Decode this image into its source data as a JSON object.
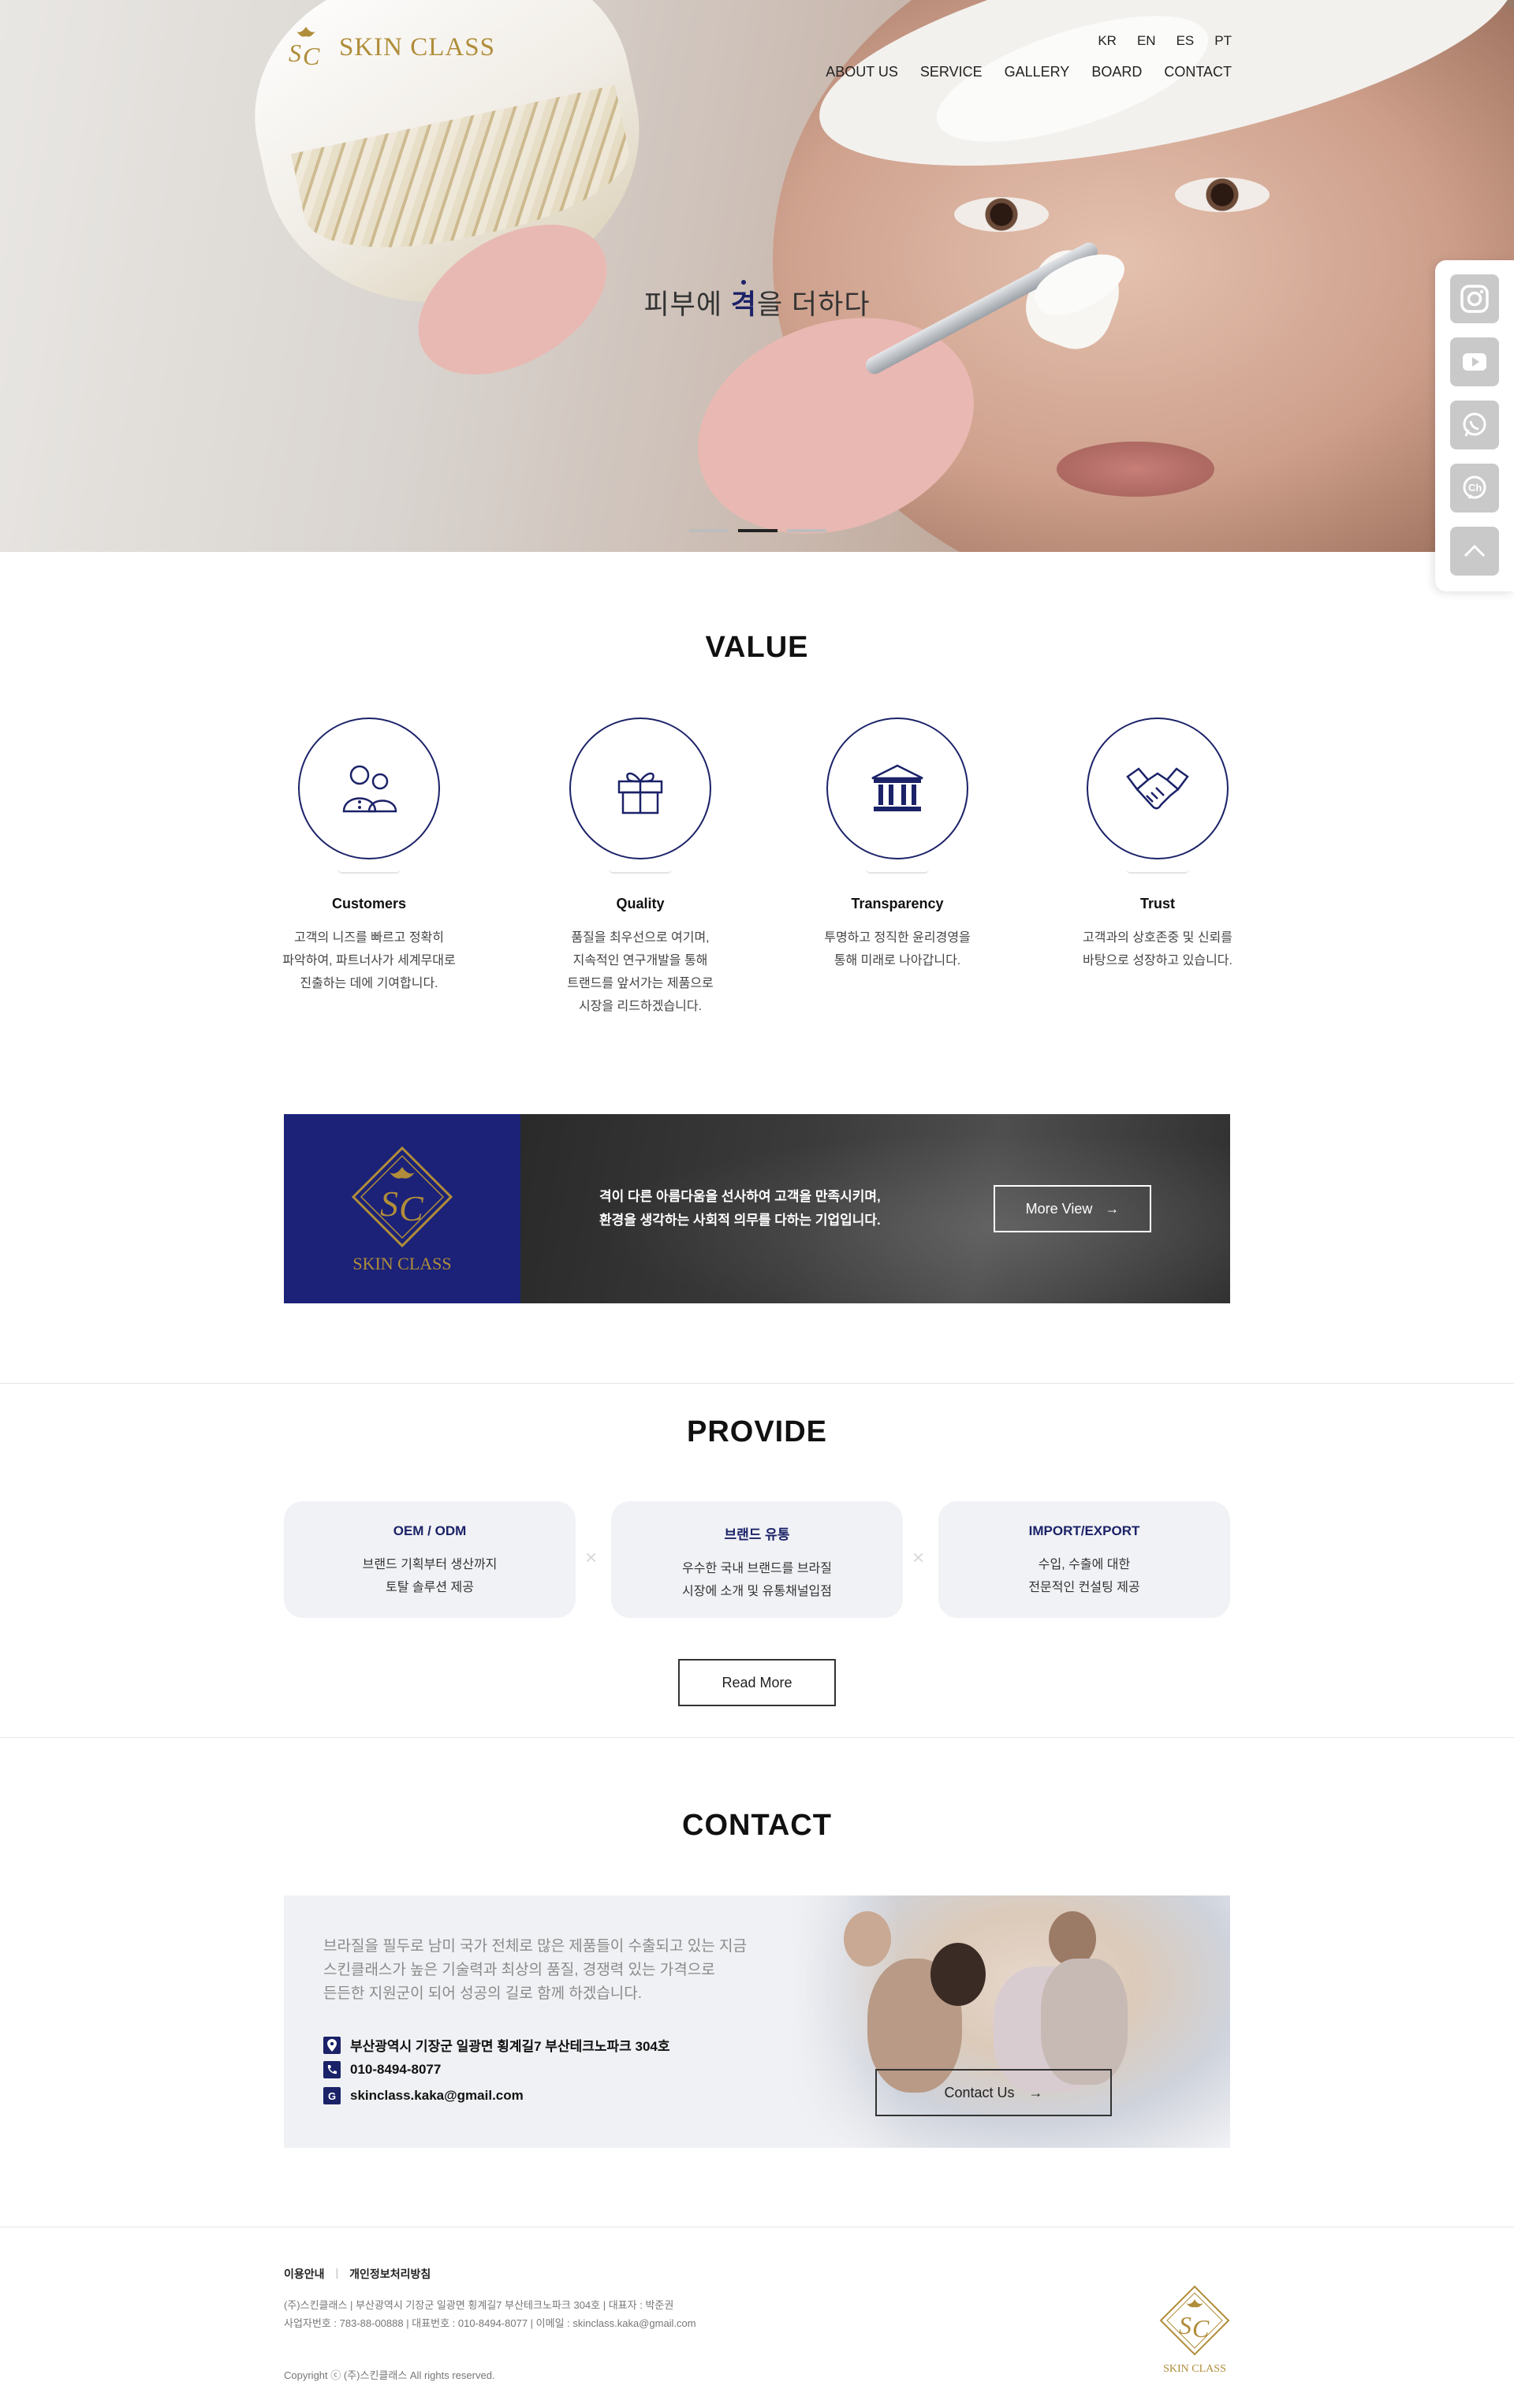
{
  "brand": {
    "name": "SKIN CLASS",
    "gold": "#b08d3a",
    "navy": "#1b2268"
  },
  "header": {
    "languages": [
      "KR",
      "EN",
      "ES",
      "PT"
    ],
    "nav": [
      "ABOUT US",
      "SERVICE",
      "GALLERY",
      "BOARD",
      "CONTACT"
    ]
  },
  "hero": {
    "copy_before": "피부에 ",
    "copy_accent": "격",
    "copy_after": "을 더하다",
    "slides": 3,
    "active_slide": 2
  },
  "quick_menu": [
    "instagram-icon",
    "youtube-icon",
    "whatsapp-icon",
    "kakao-channel-icon",
    "top-arrow-icon"
  ],
  "value": {
    "title": "VALUE",
    "items": [
      {
        "icon": "customers-icon",
        "name": "Customers",
        "desc": "고객의 니즈를 빠르고 정확히\n파악하여, 파트너사가 세계무대로\n진출하는 데에 기여합니다."
      },
      {
        "icon": "gift-icon",
        "name": "Quality",
        "desc": "품질을 최우선으로 여기며,\n지속적인 연구개발을 통해\n트랜드를 앞서가는 제품으로\n시장을 리드하겠습니다."
      },
      {
        "icon": "bank-icon",
        "name": "Transparency",
        "desc": "투명하고 정직한 윤리경영을\n통해 미래로 나아갑니다."
      },
      {
        "icon": "handshake-icon",
        "name": "Trust",
        "desc": "고객과의 상호존중 및 신뢰를\n바탕으로 성장하고 있습니다."
      }
    ]
  },
  "banner": {
    "logo_text": "SKIN CLASS",
    "text": "격이 다른 아름다움을 선사하여 고객을 만족시키며,\n환경을 생각하는 사회적 의무를 다하는 기업입니다.",
    "button": "More View",
    "arrow": "→"
  },
  "provide": {
    "title": "PROVIDE",
    "cards": [
      {
        "title": "OEM / ODM",
        "desc": "브랜드 기획부터 생산까지\n토탈 솔루션 제공"
      },
      {
        "title": "브랜드 유통",
        "desc": "우수한 국내 브랜드를 브라질\n시장에 소개 및 유통채널입점"
      },
      {
        "title": "IMPORT/EXPORT",
        "desc": "수입, 수출에 대한\n전문적인 컨설팅 제공"
      }
    ],
    "separator": "×",
    "button": "Read More"
  },
  "contact": {
    "title": "CONTACT",
    "intro": "브라질을 필두로 남미 국가 전체로 많은 제품들이 수출되고 있는 지금\n스킨클래스가 높은 기술력과 최상의 품질, 경쟁력 있는 가격으로\n든든한 지원군이 되어 성공의 길로 함께 하겠습니다.",
    "address": "부산광역시 기장군 일광면 횡계길7 부산테크노파크 304호",
    "phone": "010-8494-8077",
    "email": "skinclass.kaka@gmail.com",
    "button": "Contact Us",
    "arrow": "→"
  },
  "footer": {
    "links": [
      "이용안내",
      "개인정보처리방침"
    ],
    "info": "(주)스킨클래스 | 부산광역시 기장군 일광면 횡계길7 부산테크노파크 304호 | 대표자 : 박준권\n사업자번호 : 783-88-00888 | 대표번호 : 010-8494-8077 | 이메일 : skinclass.kaka@gmail.com",
    "copyright": "Copyright ⓒ (주)스킨클래스 All rights reserved.",
    "logo_text": "SKIN CLASS"
  }
}
